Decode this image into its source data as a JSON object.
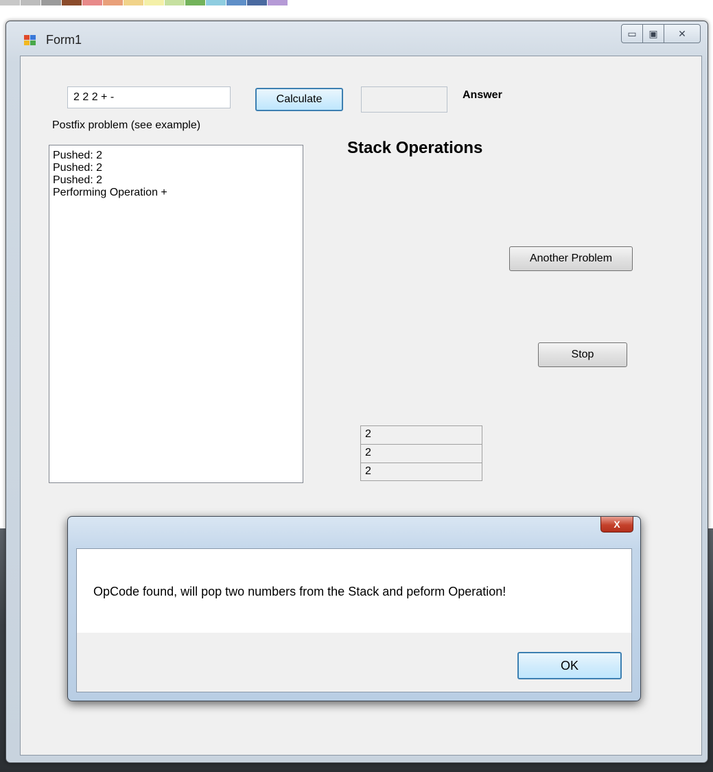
{
  "window": {
    "title": "Form1",
    "minimize_glyph": "▭",
    "maximize_glyph": "▣",
    "close_glyph": "✕"
  },
  "form": {
    "postfix_value": "2 2 2 + -",
    "postfix_label": "Postfix problem (see example)",
    "calculate_label": "Calculate",
    "answer_value": "",
    "answer_label": "Answer",
    "log_lines": [
      "Pushed: 2",
      "Pushed: 2",
      "Pushed: 2",
      "Performing Operation +"
    ],
    "stack_heading": "Stack Operations",
    "another_problem_label": "Another Problem",
    "stop_label": "Stop",
    "stack_values": [
      "2",
      "2",
      "2"
    ]
  },
  "dialog": {
    "close_glyph": "X",
    "message": "OpCode found, will pop two numbers from the Stack and peform Operation!",
    "ok_label": "OK"
  },
  "colors": {
    "palette_strip": [
      "#c8c8c8",
      "#bdbdbd",
      "#9b9b9b",
      "#8b4b2b",
      "#e88a8a",
      "#e9a07a",
      "#f1d38a",
      "#f4f0a8",
      "#c6e0a0",
      "#73b35b",
      "#8fcde0",
      "#5f8fc8",
      "#4a6aa0",
      "#b59ad6"
    ]
  }
}
